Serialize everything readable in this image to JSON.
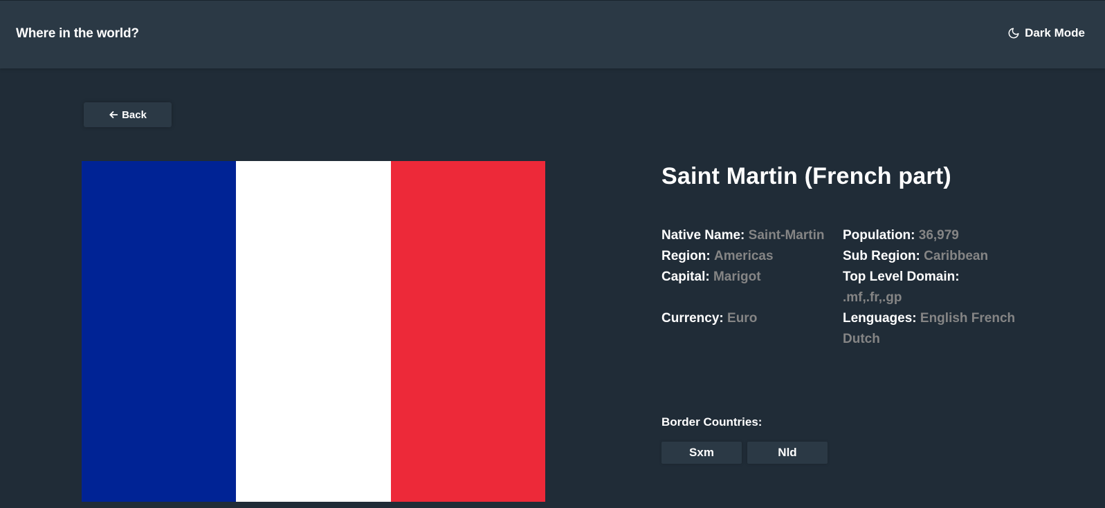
{
  "header": {
    "title": "Where in the world?",
    "theme_toggle_label": "Dark Mode",
    "theme_icon": "moon-icon"
  },
  "back_button": {
    "label": "Back",
    "icon": "arrow-left-icon"
  },
  "flag": {
    "stripes": [
      "#002395",
      "#ffffff",
      "#ed2939"
    ]
  },
  "country": {
    "name": "Saint Martin (French part)",
    "native_name_label": "Native Name:",
    "native_name": "Saint-Martin",
    "region_label": "Region:",
    "region": "Americas",
    "capital_label": "Capital:",
    "capital": "Marigot",
    "currency_label": "Currency:",
    "currency": "Euro",
    "population_label": "Population:",
    "population": "36,979",
    "sub_region_label": "Sub Region:",
    "sub_region": "Caribbean",
    "tld_label": "Top Level Domain:",
    "tld": ".mf,.fr,.gp",
    "languages_label": "Lenguages:",
    "languages_line1": "English French",
    "languages_line2": "Dutch"
  },
  "borders": {
    "label": "Border Countries:",
    "items": [
      "Sxm",
      "Nld"
    ]
  },
  "colors": {
    "background": "#202c37",
    "element": "#2b3945",
    "muted_text": "#858585"
  }
}
